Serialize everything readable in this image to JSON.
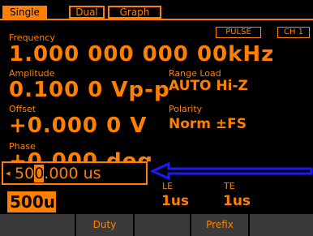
{
  "tabs": [
    {
      "label": "Single",
      "active": true
    },
    {
      "label": "Dual",
      "active": false
    },
    {
      "label": "Graph",
      "active": false
    }
  ],
  "badges": {
    "mode": "PULSE",
    "channel": "CH 1"
  },
  "frequency": {
    "label": "Frequency",
    "value": "1.000 000 000 00kHz"
  },
  "amplitude": {
    "label": "Amplitude",
    "value": "0.100 0 Vp-p"
  },
  "range_load": {
    "label": "Range Load",
    "value": "AUTO Hi-Z"
  },
  "offset": {
    "label": "Offset",
    "value": "+0.000 0 V"
  },
  "polarity": {
    "label": "Polarity",
    "value": "Norm ±FS"
  },
  "phase": {
    "label": "Phase",
    "value_partial": "+0.000 deg"
  },
  "edit": {
    "arrow": "◂",
    "digits_before": "50",
    "cursor_digit": "0",
    "digits_after": ".000 us"
  },
  "period_value": "500us",
  "le": {
    "label": "LE",
    "value": "1us"
  },
  "te": {
    "label": "TE",
    "value": "1us"
  },
  "softkeys": [
    "",
    "Duty",
    "",
    "Prefix",
    ""
  ],
  "colors": {
    "accent": "#ff8000",
    "annotation_arrow": "#1a1aff",
    "background": "#000000",
    "softkey": "#3a3a3a"
  }
}
